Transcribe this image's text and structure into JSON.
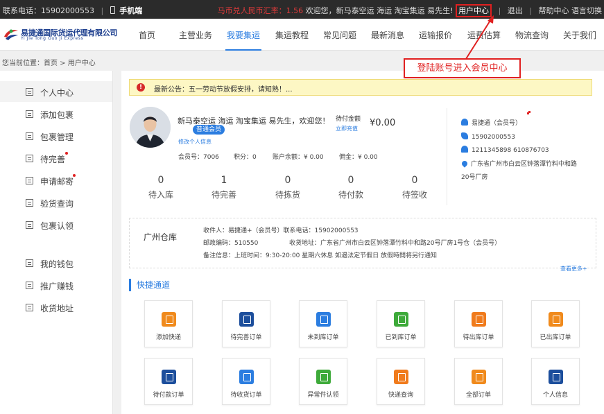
{
  "topbar": {
    "hotline": "联系电话：15902000553",
    "mobile": "手机端",
    "rate": "马币兑人民币汇率：1.56",
    "welcome": "欢迎您，新马泰空运 海运 淘宝集运 易先生!",
    "user_center": "用户中心",
    "logout": "退出",
    "help": "帮助中心",
    "language": "语言切换"
  },
  "logo": {
    "cn": "易捷通国际货运代理有限公司",
    "en": "Yi Jie Tong Guo Ji Express"
  },
  "nav": [
    "首页",
    "主营业务",
    "我要集运",
    "集运教程",
    "常见问题",
    "最新消息",
    "运输报价",
    "运费估算",
    "物流查询",
    "关于我们"
  ],
  "breadcrumb": "您当前位置：首页 > 用户中心",
  "sidebar": {
    "items": [
      "个人中心",
      "添加包裹",
      "包裹管理",
      "待完善",
      "申请邮寄",
      "验货查询",
      "包裹认领"
    ],
    "items2": [
      "我的钱包",
      "推广赚钱",
      "收货地址"
    ]
  },
  "notice": {
    "icon": "!",
    "text": "最新公告：五一劳动节放假安排，请知熟！..."
  },
  "profile": {
    "welcome": "新马泰空运 海运 淘宝集运 易先生，欢迎您！",
    "badge": "普通会员",
    "edit": "修改个人信息",
    "pending_label": "待付金额",
    "pending_amount": "¥0.00",
    "pay_now": "立即充值",
    "member_no": "会员号：7006",
    "points": "积分：0",
    "balance": "账户余额：¥ 0.00",
    "commission": "佣金：¥ 0.00"
  },
  "counters": [
    {
      "num": "0",
      "label": "待入库"
    },
    {
      "num": "1",
      "label": "待完善"
    },
    {
      "num": "0",
      "label": "待拣货"
    },
    {
      "num": "0",
      "label": "待付款"
    },
    {
      "num": "0",
      "label": "待签收"
    }
  ],
  "contact": {
    "name": "易捷通（会员号）",
    "phone": "15902000553",
    "qq": "1211345898  610876703",
    "address1": "广东省广州市白云区钟落潭竹料中和路",
    "address2": "20号厂房"
  },
  "warehouse": {
    "title": "广州仓库",
    "receiver": "收件人：易捷通+（会员号）联系电话：15902000553",
    "postcode": "邮政编码：510550",
    "address": "收货地址：广东省广州市白云区钟落潭竹料中和路20号厂房1号仓（会员号）",
    "remark": "备注信息：上班时间：9:30-20:00 星期六休息 如遇法定节假日 放假時間将另行通知",
    "more": "查看更多+"
  },
  "quick": {
    "title": "快捷通道",
    "items": [
      {
        "label": "添加快递",
        "color": "#f08a1c"
      },
      {
        "label": "待完善订单",
        "color": "#1c4e9c"
      },
      {
        "label": "未到库订单",
        "color": "#2b7de0"
      },
      {
        "label": "已到库订单",
        "color": "#3eaa3a"
      },
      {
        "label": "待出库订单",
        "color": "#f07b1c"
      },
      {
        "label": "已出库订单",
        "color": "#f08a1c"
      },
      {
        "label": "待付款订单",
        "color": "#1c4e9c"
      },
      {
        "label": "待收货订单",
        "color": "#2b7de0"
      },
      {
        "label": "异常件认领",
        "color": "#3eaa3a"
      },
      {
        "label": "快递查询",
        "color": "#f07b1c"
      },
      {
        "label": "全部订单",
        "color": "#f08a1c"
      },
      {
        "label": "个人信息",
        "color": "#1c4e9c"
      }
    ]
  },
  "annotation": "登陆账号进入会员中心",
  "colors": {
    "accent": "#2b7de0",
    "alert": "#e02020",
    "topbar": "#2b2b2b"
  }
}
